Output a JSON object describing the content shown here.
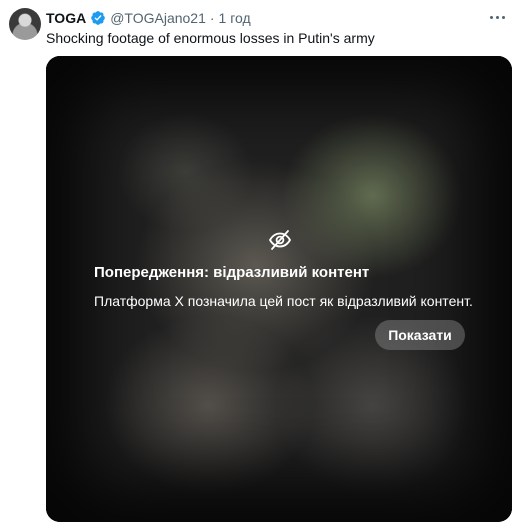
{
  "post": {
    "author_name": "TOGA",
    "handle": "@TOGAjano21",
    "separator": "·",
    "time": "1 год",
    "text": "Shocking footage of enormous losses in Putin's army",
    "avatar_icon": "profile-photo",
    "verified_icon": "verified-badge-icon",
    "more_icon": "more-options-icon"
  },
  "warning": {
    "icon": "eye-slash-icon",
    "title": "Попередження: відразливий контент",
    "description": "Платформа X позначила цей пост як відразливий контент.",
    "show_button": "Показати"
  },
  "colors": {
    "accent": "#1d9bf0",
    "text_primary": "#0f1419",
    "text_secondary": "#536471"
  }
}
